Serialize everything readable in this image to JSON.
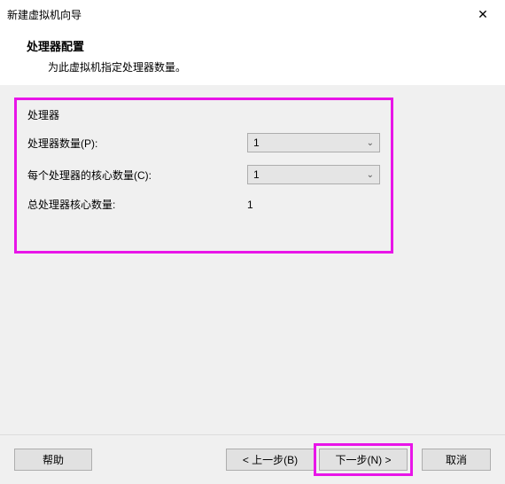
{
  "window": {
    "title": "新建虚拟机向导"
  },
  "header": {
    "title": "处理器配置",
    "subtitle": "为此虚拟机指定处理器数量。"
  },
  "section": {
    "label": "处理器"
  },
  "fields": {
    "processor_count": {
      "label": "处理器数量(P):",
      "value": "1"
    },
    "cores_per": {
      "label": "每个处理器的核心数量(C):",
      "value": "1"
    },
    "total": {
      "label": "总处理器核心数量:",
      "value": "1"
    }
  },
  "buttons": {
    "help": "帮助",
    "back": "< 上一步(B)",
    "next": "下一步(N) >",
    "cancel": "取消"
  }
}
